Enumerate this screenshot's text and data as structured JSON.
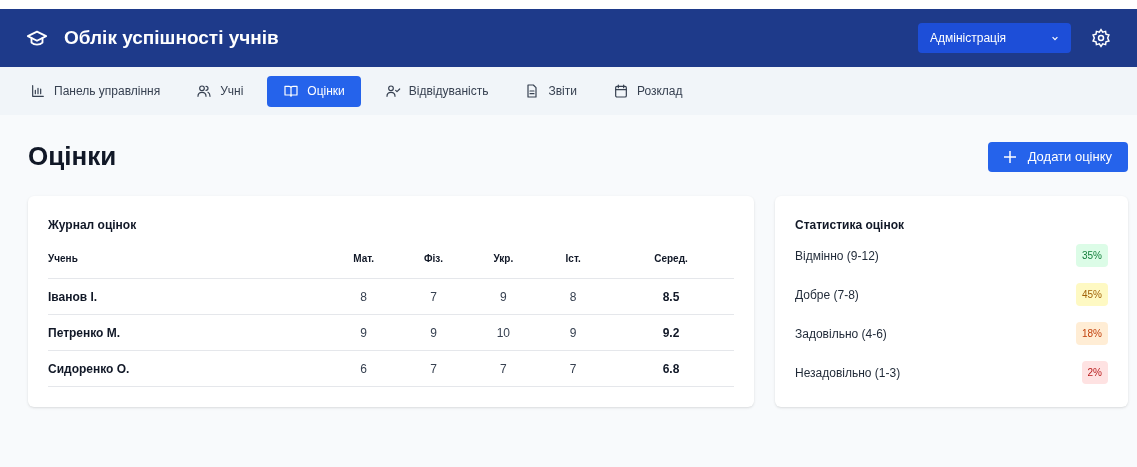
{
  "header": {
    "title": "Облік успішності учнів",
    "role_select": {
      "value": "Адміністрація"
    }
  },
  "tabs": [
    {
      "label": "Панель управління",
      "kind": "chart",
      "selected": false
    },
    {
      "label": "Учні",
      "kind": "users",
      "selected": false
    },
    {
      "label": "Оцінки",
      "kind": "book",
      "selected": true
    },
    {
      "label": "Відвідуваність",
      "kind": "usercheck",
      "selected": false
    },
    {
      "label": "Звіти",
      "kind": "file",
      "selected": false
    },
    {
      "label": "Розклад",
      "kind": "calendar",
      "selected": false
    }
  ],
  "page": {
    "title": "Оцінки",
    "add_button": "Додати оцінку"
  },
  "journal": {
    "title": "Журнал оцінок",
    "columns": [
      "Учень",
      "Мат.",
      "Фіз.",
      "Укр.",
      "Іст.",
      "Серед."
    ],
    "rows": [
      [
        "Іванов І.",
        "8",
        "7",
        "9",
        "8",
        "8.5"
      ],
      [
        "Петренко М.",
        "9",
        "9",
        "10",
        "9",
        "9.2"
      ],
      [
        "Сидоренко О.",
        "6",
        "7",
        "7",
        "7",
        "6.8"
      ]
    ]
  },
  "stats": {
    "title": "Статистика оцінок",
    "items": [
      {
        "label": "Відмінно (9-12)",
        "value": "35%",
        "color": "#dcfce7"
      },
      {
        "label": "Добре (7-8)",
        "value": "45%",
        "color": "#fef9c3"
      },
      {
        "label": "Задовільно (4-6)",
        "value": "18%",
        "color": "#ffedd5"
      },
      {
        "label": "Незадовільно (1-3)",
        "value": "2%",
        "color": "#fee2e2"
      }
    ]
  }
}
